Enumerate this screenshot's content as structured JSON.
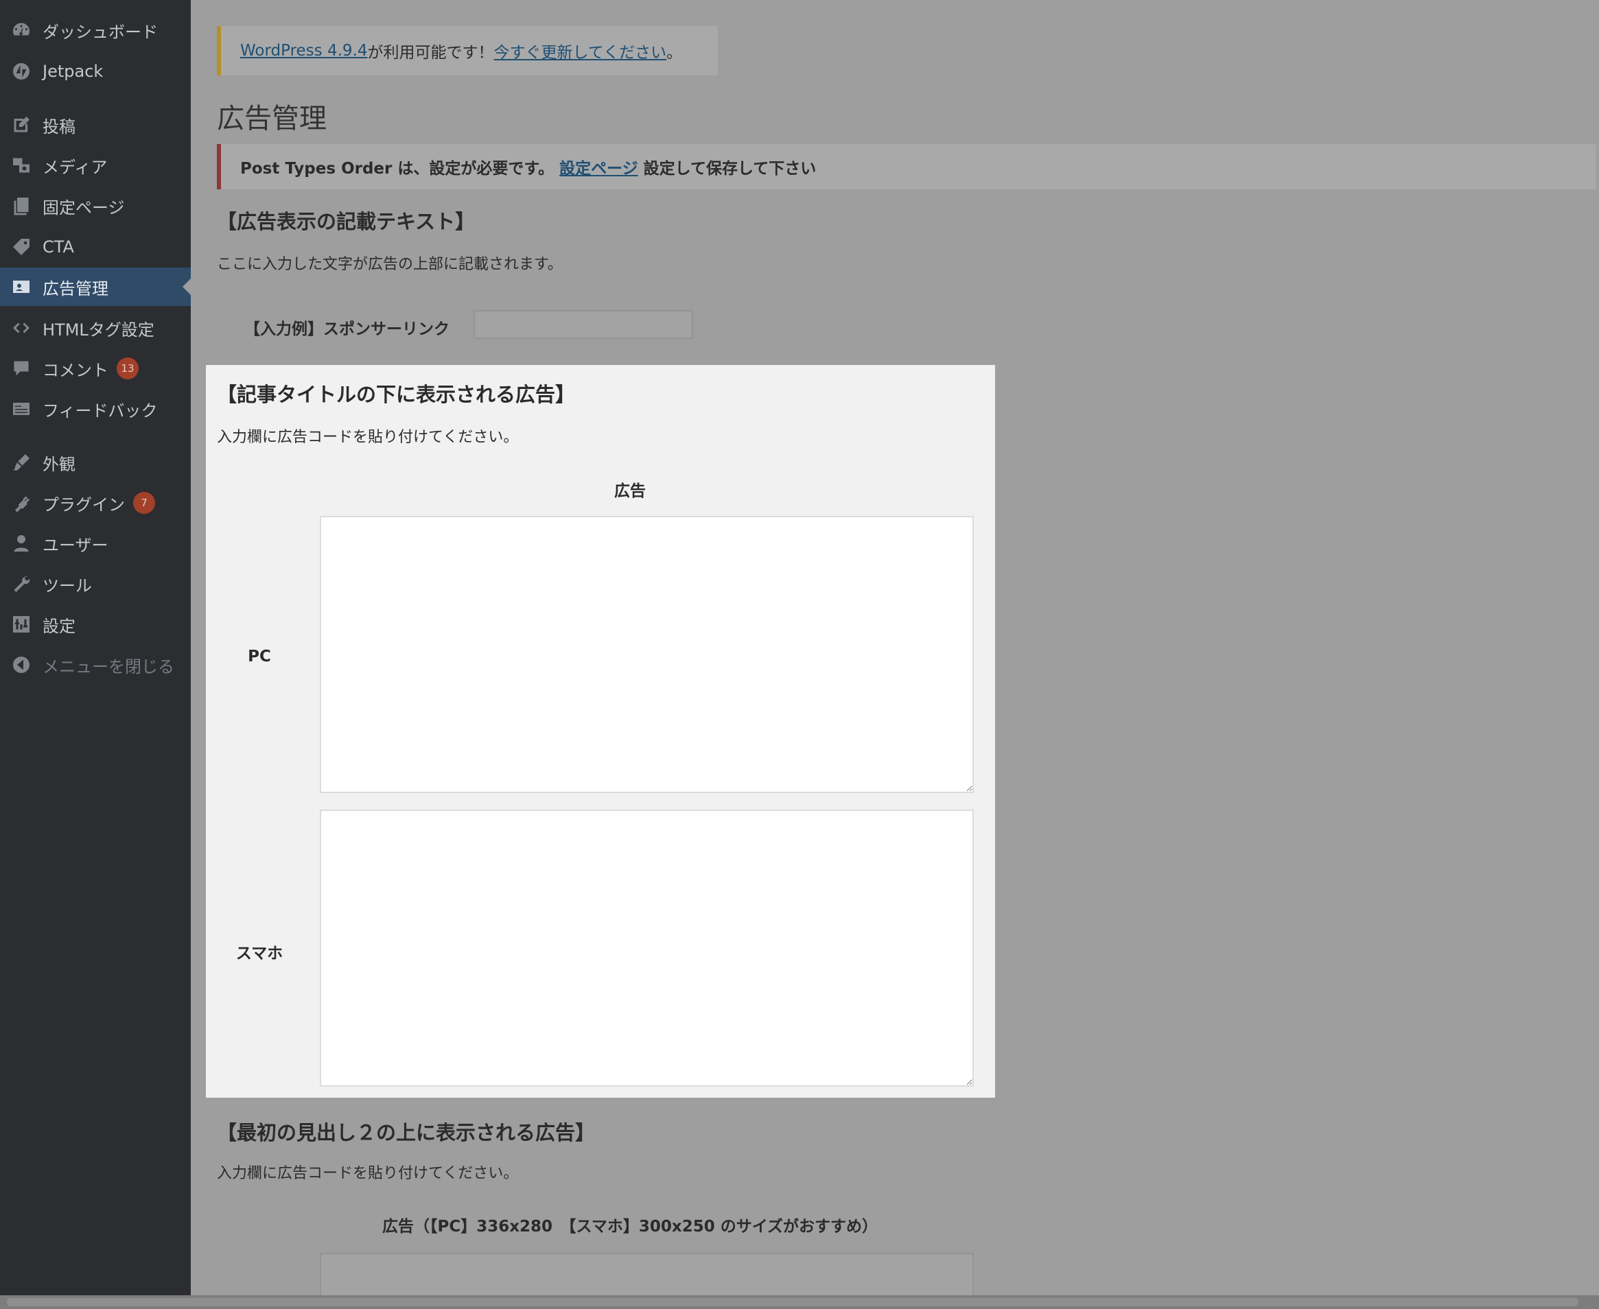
{
  "sidebar": {
    "items": [
      {
        "label": "ダッシュボード",
        "icon": "dashboard-icon"
      },
      {
        "label": "Jetpack",
        "icon": "jetpack-icon"
      },
      {
        "label": "投稿",
        "icon": "posts-icon"
      },
      {
        "label": "メディア",
        "icon": "media-icon"
      },
      {
        "label": "固定ページ",
        "icon": "pages-icon"
      },
      {
        "label": "CTA",
        "icon": "cta-icon"
      },
      {
        "label": "広告管理",
        "icon": "ads-icon",
        "active": true
      },
      {
        "label": "HTMLタグ設定",
        "icon": "code-icon"
      },
      {
        "label": "コメント",
        "icon": "comments-icon",
        "badge": "13"
      },
      {
        "label": "フィードバック",
        "icon": "feedback-icon"
      },
      {
        "label": "外観",
        "icon": "appearance-icon"
      },
      {
        "label": "プラグイン",
        "icon": "plugins-icon",
        "badge": "7"
      },
      {
        "label": "ユーザー",
        "icon": "users-icon"
      },
      {
        "label": "ツール",
        "icon": "tools-icon"
      },
      {
        "label": "設定",
        "icon": "settings-icon"
      },
      {
        "label": "メニューを閉じる",
        "icon": "collapse-icon"
      }
    ]
  },
  "notices": {
    "update": {
      "link1": "WordPress 4.9.4",
      "text": " が利用可能です！",
      "link2": "今すぐ更新してください",
      "tail": "。"
    },
    "pto": {
      "text": "Post Types Order は、設定が必要です。 ",
      "link": "設定ページ",
      "tail": " 設定して保存して下さい"
    }
  },
  "page": {
    "title": "広告管理"
  },
  "section_text": {
    "title": "【広告表示の記載テキスト】",
    "desc": "ここに入力した文字が広告の上部に記載されます。",
    "field_label": "【入力例】スポンサーリンク",
    "field_value": ""
  },
  "section_below_title": {
    "title": "【記事タイトルの下に表示される広告】",
    "desc": "入力欄に広告コードを貼り付けてください。",
    "column_header": "広告",
    "rows": [
      {
        "label": "PC",
        "value": ""
      },
      {
        "label": "スマホ",
        "value": ""
      }
    ]
  },
  "section_h2": {
    "title": "【最初の見出し２の上に表示される広告】",
    "desc": "入力欄に広告コードを貼り付けてください。",
    "column_header": "広告（【PC】336x280　【スマホ】300x250 のサイズがおすすめ）"
  },
  "colors": {
    "sidebar_bg": "#2c2d31",
    "active_bg": "#2f4b68",
    "overlay_bg": "#9e9e9e",
    "panel_bg": "#f1f1f1",
    "badge_bg": "#a3402a"
  }
}
